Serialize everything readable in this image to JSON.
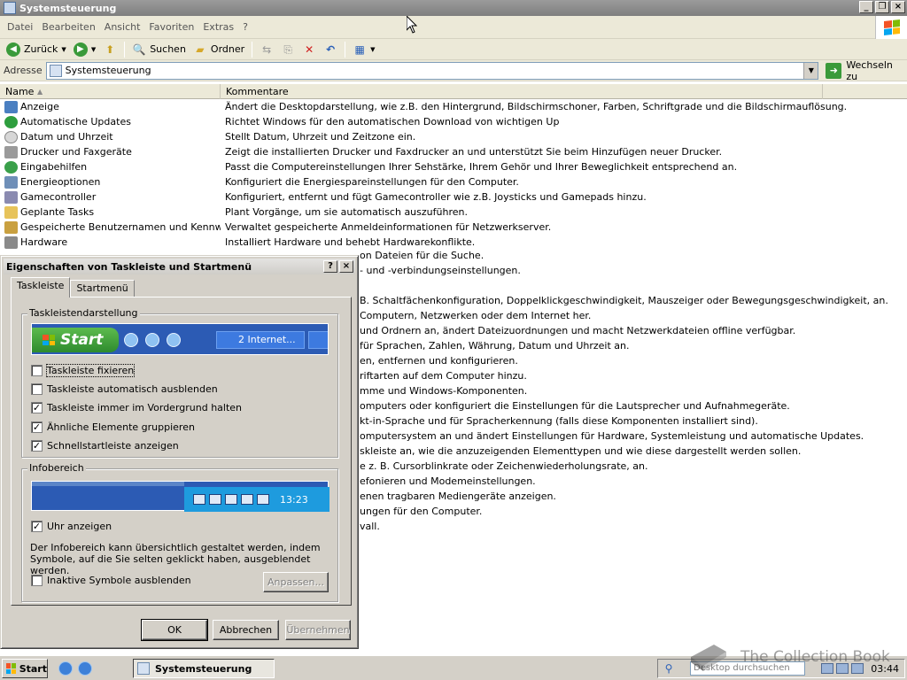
{
  "window": {
    "title": "Systemsteuerung"
  },
  "menu": [
    {
      "label": "Datei"
    },
    {
      "label": "Bearbeiten"
    },
    {
      "label": "Ansicht"
    },
    {
      "label": "Favoriten"
    },
    {
      "label": "Extras"
    },
    {
      "label": "?"
    }
  ],
  "toolbar": {
    "back": "Zurück",
    "search": "Suchen",
    "folders": "Ordner"
  },
  "address": {
    "label": "Adresse",
    "value": "Systemsteuerung",
    "go": "Wechseln zu"
  },
  "columns": {
    "name": "Name",
    "comment": "Kommentare"
  },
  "items": [
    {
      "name": "Anzeige",
      "comment": "Ändert die Desktopdarstellung, wie z.B. den Hintergrund, Bildschirmschoner, Farben, Schriftgrade und die Bildschirmauflösung.",
      "color": "#4a7fc1"
    },
    {
      "name": "Automatische Updates",
      "comment": "Richtet Windows für den automatischen Download von wichtigen Up",
      "color": "#2e9e3e"
    },
    {
      "name": "Datum und Uhrzeit",
      "comment": "Stellt Datum, Uhrzeit und Zeitzone ein.",
      "color": "#d7d7d7"
    },
    {
      "name": "Drucker und Faxgeräte",
      "comment": "Zeigt die installierten Drucker und Faxdrucker an und unterstützt Sie beim Hinzufügen neuer Drucker.",
      "color": "#9a9a9a"
    },
    {
      "name": "Eingabehilfen",
      "comment": "Passt die Computereinstellungen Ihrer Sehstärke, Ihrem Gehör und Ihrer Beweglichkeit entsprechend an.",
      "color": "#3aa04a"
    },
    {
      "name": "Energieoptionen",
      "comment": "Konfiguriert die Energiespareinstellungen für den Computer.",
      "color": "#6f8fb8"
    },
    {
      "name": "Gamecontroller",
      "comment": "Konfiguriert, entfernt und fügt Gamecontroller wie z.B. Joysticks und Gamepads hinzu.",
      "color": "#8a8ab0"
    },
    {
      "name": "Geplante Tasks",
      "comment": "Plant Vorgänge, um sie automatisch auszuführen.",
      "color": "#e7c35a"
    },
    {
      "name": "Gespeicherte Benutzernamen und Kennwörter",
      "comment": "Verwaltet gespeicherte Anmeldeinformationen für Netzwerkserver.",
      "color": "#c9a040"
    },
    {
      "name": "Hardware",
      "comment": "Installiert Hardware und behebt Hardwarekonflikte.",
      "color": "#8a8a8a"
    }
  ],
  "partial_comments": [
    "on Dateien für die Suche.",
    "- und -verbindungseinstellungen.",
    "",
    "B. Schaltfächenkonfiguration, Doppelklickgeschwindigkeit, Mauszeiger oder Bewegungsgeschwindigkeit, an.",
    "Computern, Netzwerken oder dem Internet her.",
    "und Ordnern an, ändert Dateizuordnungen und macht Netzwerkdateien offline verfügbar.",
    "für Sprachen, Zahlen, Währung, Datum und Uhrzeit an.",
    "en, entfernen und konfigurieren.",
    "riftarten auf dem Computer hinzu.",
    "mme und Windows-Komponenten.",
    "omputers oder konfiguriert die Einstellungen für die Lautsprecher und Aufnahmegeräte.",
    "kt-in-Sprache und für Spracherkennung (falls diese Komponenten installiert sind).",
    "omputersystem an und ändert Einstellungen für Hardware, Systemleistung und automatische Updates.",
    "skleiste an, wie die anzuzeigenden Elementtypen und wie diese dargestellt werden sollen.",
    "e z. B. Cursorblinkrate oder Zeichenwiederholungsrate, an.",
    "efonieren und Modemeinstellungen.",
    "enen tragbaren Mediengeräte anzeigen.",
    "ungen für den Computer.",
    "vall."
  ],
  "dialog": {
    "title": "Eigenschaften von Taskleiste und Startmenü",
    "help_btn": "?",
    "close_btn": "×",
    "tabs": [
      "Taskleiste",
      "Startmenü"
    ],
    "group1": "Taskleistendarstellung",
    "preview_start": "Start",
    "preview_task": "2 Internet...",
    "options": [
      {
        "label": "Taskleiste fixieren",
        "checked": false,
        "mark": ""
      },
      {
        "label": "Taskleiste automatisch ausblenden",
        "checked": false,
        "mark": ""
      },
      {
        "label": "Taskleiste immer im Vordergrund halten",
        "checked": true,
        "mark": "✓"
      },
      {
        "label": "Ähnliche Elemente gruppieren",
        "checked": true,
        "mark": "✓"
      },
      {
        "label": "Schnellstartleiste anzeigen",
        "checked": true,
        "mark": "✓"
      }
    ],
    "group2": "Infobereich",
    "tray_time": "13:23",
    "clock_option": {
      "label": "Uhr anzeigen",
      "checked": true,
      "mark": "✓"
    },
    "description": "Der Infobereich kann übersichtlich gestaltet werden, indem Symbole, auf die Sie selten geklickt haben, ausgeblendet werden.",
    "inactive_option": {
      "label": "Inaktive Symbole ausblenden",
      "checked": false,
      "mark": ""
    },
    "customize": "Anpassen...",
    "ok": "OK",
    "cancel": "Abbrechen",
    "apply": "Übernehmen"
  },
  "taskbar": {
    "start": "Start",
    "task": "Systemsteuerung",
    "search_placeholder": "Desktop durchsuchen",
    "clock": "03:44"
  },
  "watermark": "The Collection Book",
  "colors": {
    "preview_blue": "#2c5bb4",
    "start_green": "#3aa03a",
    "tray_blue": "#1e9bde"
  }
}
